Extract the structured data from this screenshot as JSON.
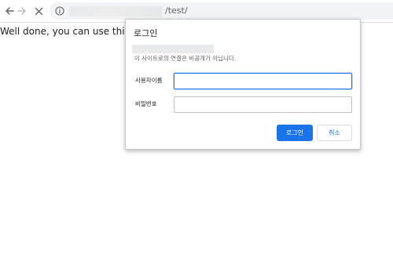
{
  "browser": {
    "url_path": "/test/",
    "icons": {
      "back": "arrow-left-icon",
      "forward": "arrow-right-icon",
      "stop": "close-icon",
      "site_info": "info-icon"
    }
  },
  "page": {
    "body_text": "Well done, you can use this passw"
  },
  "login_dialog": {
    "title": "로그인",
    "notice": "이 사이트로의 연결은 비공개가 아닙니다.",
    "username_label": "사용자이름",
    "username_value": "",
    "password_label": "비밀번호",
    "password_value": "",
    "login_button": "로그인",
    "cancel_button": "취소"
  },
  "colors": {
    "accent": "#1a73e8",
    "omnibox_bg": "#f1f3f4",
    "secondary_text": "#5f6368"
  }
}
